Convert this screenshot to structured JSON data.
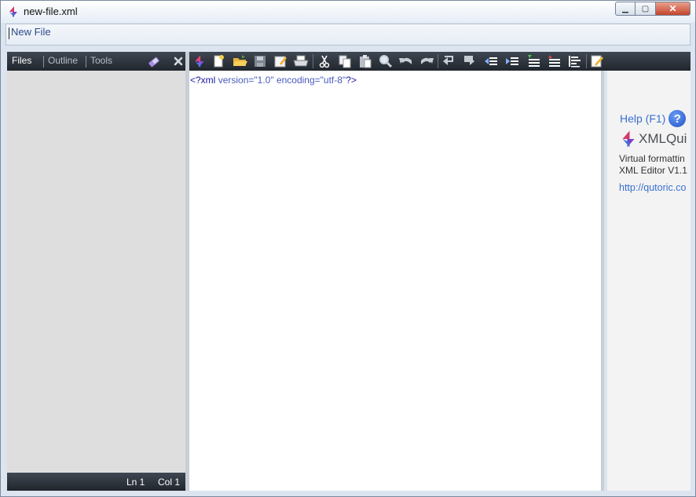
{
  "window": {
    "title": "new-file.xml",
    "icon": "xmlquire-logo-icon",
    "controls": [
      "minimize-icon",
      "maximize-icon",
      "close-icon"
    ]
  },
  "address_bar": {
    "value": "New File"
  },
  "left_panel": {
    "tabs": [
      {
        "label": "Files",
        "active": true
      },
      {
        "label": "Outline",
        "active": false
      },
      {
        "label": "Tools",
        "active": false
      }
    ],
    "icons": [
      "eraser-icon",
      "close-icon"
    ],
    "status": {
      "line": "Ln 1",
      "col": "Col 1"
    }
  },
  "toolbar": {
    "buttons": [
      "xmlquire-logo-icon",
      "new-file-icon",
      "open-folder-icon",
      "save-icon",
      "save-as-icon",
      "print-icon",
      "cut-icon",
      "copy-icon",
      "paste-icon",
      "find-icon",
      "undo-icon",
      "redo-icon",
      "move-up-icon",
      "move-down-icon",
      "outdent-icon",
      "indent-icon",
      "expand-icon",
      "collapse-icon",
      "format-icon",
      "edit-icon"
    ]
  },
  "editor": {
    "line1": {
      "open": "<?xml",
      "attr1": "version=\"1.0\"",
      "attr2": "encoding=\"utf-8\"",
      "close": "?>"
    }
  },
  "side_panel": {
    "help_label": "Help (F1)",
    "help_icon": "help-icon",
    "brand": "XMLQui",
    "description_line1": "Virtual formattin",
    "description_line2": "XML Editor V1.1",
    "link": "http://qutoric.co"
  },
  "colors": {
    "toolbar_dark": "#21262d",
    "link_blue": "#3a6fd0",
    "xml_blue": "#1a1aa6"
  }
}
